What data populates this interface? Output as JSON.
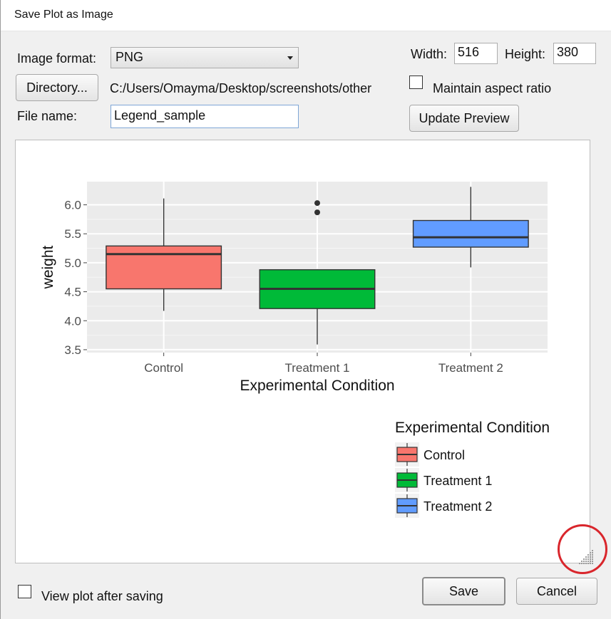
{
  "window": {
    "title": "Save Plot as Image"
  },
  "format": {
    "label": "Image format:",
    "selected": "PNG"
  },
  "directory": {
    "button_label": "Directory...",
    "path": "C:/Users/Omayma/Desktop/screenshots/other"
  },
  "filename": {
    "label": "File name:",
    "value": "Legend_sample"
  },
  "size": {
    "width_label": "Width:",
    "width_value": "516",
    "height_label": "Height:",
    "height_value": "380",
    "aspect_label": "Maintain aspect ratio",
    "aspect_checked": false
  },
  "update_preview_label": "Update Preview",
  "footer": {
    "view_after_label": "View plot after saving",
    "view_after_checked": false,
    "save_label": "Save",
    "cancel_label": "Cancel"
  },
  "colors": {
    "control": "#F8766D",
    "treatment1": "#00BA38",
    "treatment2": "#619CFF",
    "panel_bg": "#EBEBEB",
    "annotation": "#D9262C"
  },
  "chart_data": {
    "type": "boxplot",
    "xlabel": "Experimental Condition",
    "ylabel": "weight",
    "categories": [
      "Control",
      "Treatment 1",
      "Treatment 2"
    ],
    "ylim": [
      3.45,
      6.4
    ],
    "yticks": [
      3.5,
      4.0,
      4.5,
      5.0,
      5.5,
      6.0
    ],
    "ytick_labels": [
      "3.5",
      "4.0",
      "4.5",
      "5.0",
      "5.5",
      "6.0"
    ],
    "boxes": [
      {
        "name": "Control",
        "min": 4.17,
        "q1": 4.55,
        "median": 5.15,
        "q3": 5.29,
        "max": 6.11,
        "outliers": []
      },
      {
        "name": "Treatment 1",
        "min": 3.59,
        "q1": 4.21,
        "median": 4.55,
        "q3": 4.88,
        "max": 4.89,
        "outliers": [
          5.87,
          6.03
        ]
      },
      {
        "name": "Treatment 2",
        "min": 4.92,
        "q1": 5.27,
        "median": 5.44,
        "q3": 5.73,
        "max": 6.31,
        "outliers": []
      }
    ],
    "legend": {
      "title": "Experimental Condition",
      "position": "bottom-right",
      "entries": [
        "Control",
        "Treatment 1",
        "Treatment 2"
      ]
    },
    "grid": true
  }
}
